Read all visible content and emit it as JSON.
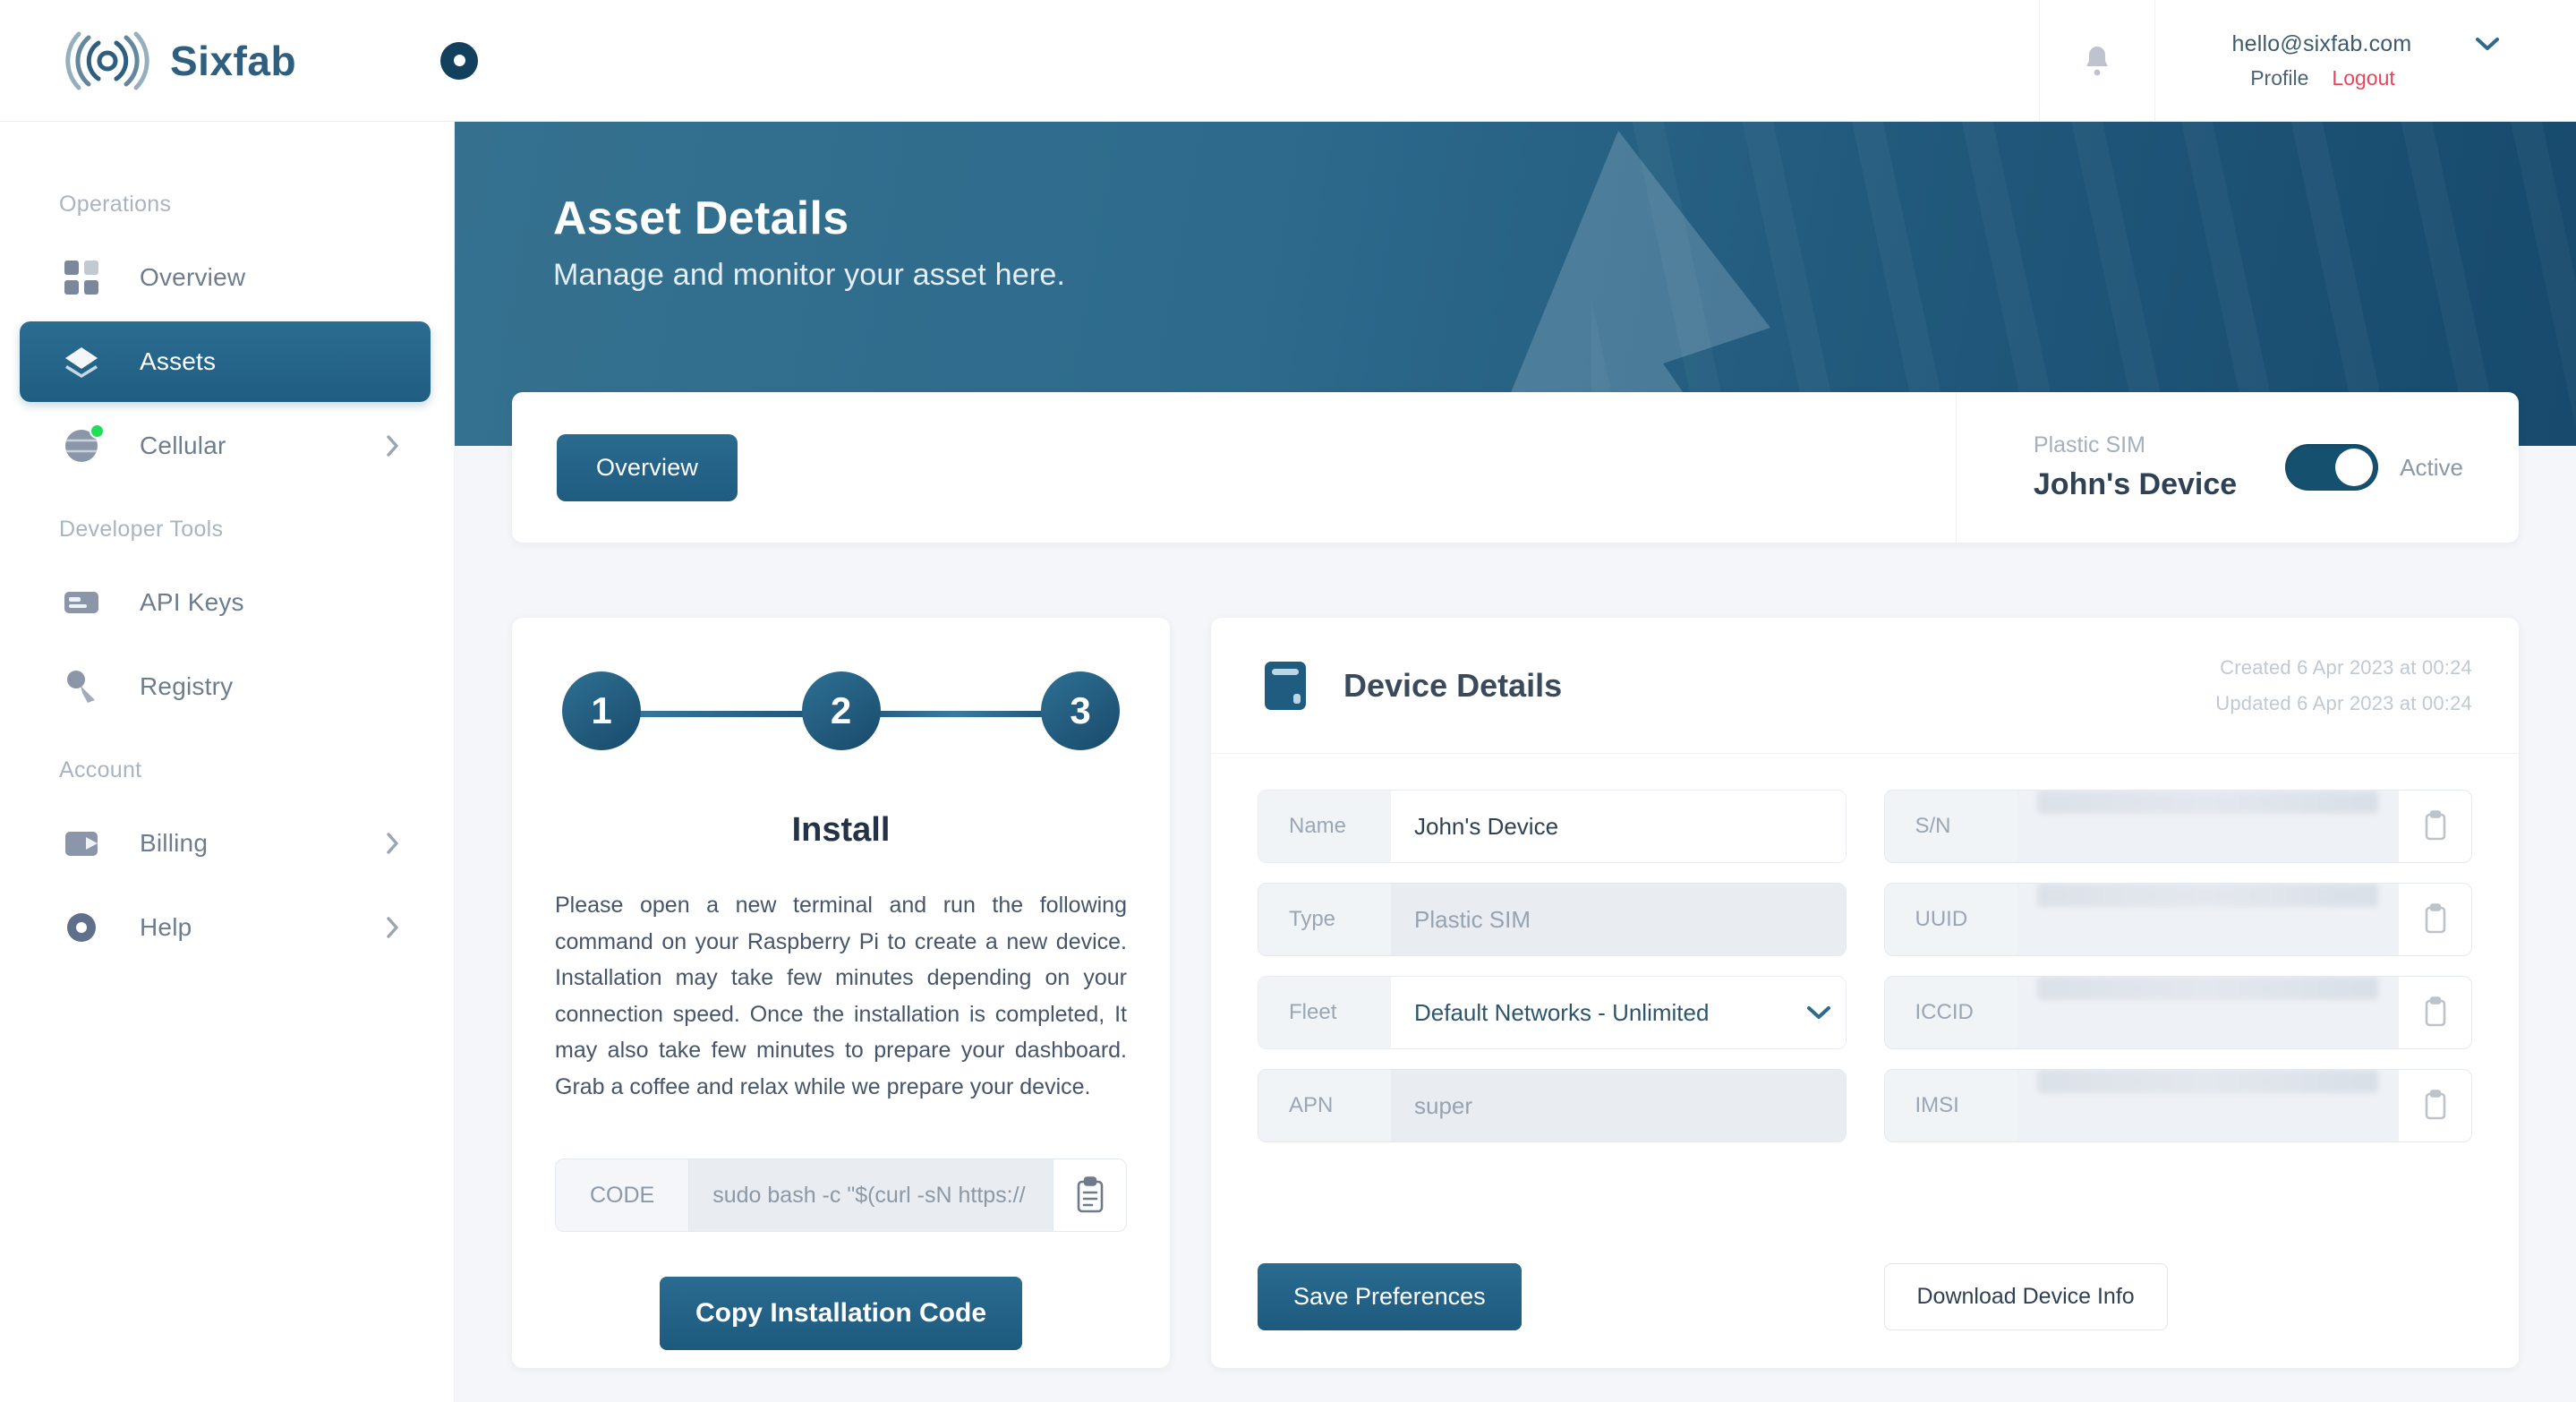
{
  "brand": {
    "name": "Sixfab",
    "logo_icon": "sixfab-waves-icon",
    "badge_icon": "status-dot-icon"
  },
  "topbar": {
    "bell_icon": "notification-bell-icon",
    "email": "hello@sixfab.com",
    "chevron_icon": "chevron-down-icon",
    "profile_label": "Profile",
    "logout_label": "Logout"
  },
  "sidebar": {
    "sections": [
      {
        "title": "Operations",
        "items": [
          {
            "label": "Overview",
            "icon": "grid-squares-icon",
            "active": false,
            "chevron": false,
            "dot": false
          },
          {
            "label": "Assets",
            "icon": "layers-icon",
            "active": true,
            "chevron": false,
            "dot": false
          },
          {
            "label": "Cellular",
            "icon": "globe-icon",
            "active": false,
            "chevron": true,
            "dot": true
          }
        ]
      },
      {
        "title": "Developer Tools",
        "items": [
          {
            "label": "API Keys",
            "icon": "key-card-icon",
            "active": false,
            "chevron": false,
            "dot": false
          },
          {
            "label": "Registry",
            "icon": "registry-icon",
            "active": false,
            "chevron": false,
            "dot": false
          }
        ]
      },
      {
        "title": "Account",
        "items": [
          {
            "label": "Billing",
            "icon": "wallet-icon",
            "active": false,
            "chevron": true,
            "dot": false
          },
          {
            "label": "Help",
            "icon": "help-circle-icon",
            "active": false,
            "chevron": true,
            "dot": false
          }
        ]
      }
    ]
  },
  "hero": {
    "title": "Asset Details",
    "subtitle": "Manage and monitor your asset here."
  },
  "status_card": {
    "tab_label": "Overview",
    "sim_type": "Plastic SIM",
    "device_name": "John's Device",
    "toggle_on": true,
    "toggle_label": "Active"
  },
  "install_card": {
    "steps": [
      "1",
      "2",
      "3"
    ],
    "title": "Install",
    "description": "Please open a new terminal and run the following command on your Raspberry Pi to create a new device. Installation may take few minutes depending on your connection speed. Once the installation is completed, It may also take few minutes to prepare your dashboard. Grab a coffee and relax while we prepare your device.",
    "code_label": "CODE",
    "code_value": "sudo bash -c \"$(curl -sN https://",
    "copy_icon": "clipboard-icon",
    "copy_button_label": "Copy Installation Code"
  },
  "device_card": {
    "icon": "device-book-icon",
    "title": "Device Details",
    "created": "Created 6 Apr 2023 at 00:24",
    "updated": "Updated 6 Apr 2023 at 00:24",
    "left_fields": [
      {
        "label": "Name",
        "value": "John's Device",
        "type": "text",
        "readonly": false
      },
      {
        "label": "Type",
        "value": "Plastic SIM",
        "type": "text",
        "readonly": true
      },
      {
        "label": "Fleet",
        "value": "Default Networks - Unlimited",
        "type": "select",
        "readonly": false
      },
      {
        "label": "APN",
        "value": "super",
        "type": "text",
        "readonly": true
      }
    ],
    "right_fields": [
      {
        "label": "S/N",
        "value": "",
        "type": "redacted",
        "readonly": true
      },
      {
        "label": "UUID",
        "value": "",
        "type": "redacted",
        "readonly": true
      },
      {
        "label": "ICCID",
        "value": "",
        "type": "redacted",
        "readonly": true
      },
      {
        "label": "IMSI",
        "value": "",
        "type": "redacted",
        "readonly": true
      }
    ],
    "copy_icon": "copy-icon",
    "save_label": "Save Preferences",
    "download_label": "Download Device Info"
  },
  "colors": {
    "accent": "#2a6b90",
    "accent_dark": "#174a6c",
    "logout_red": "#e8455c",
    "status_green": "#22dd56",
    "page_bg": "#f4f6f9"
  }
}
